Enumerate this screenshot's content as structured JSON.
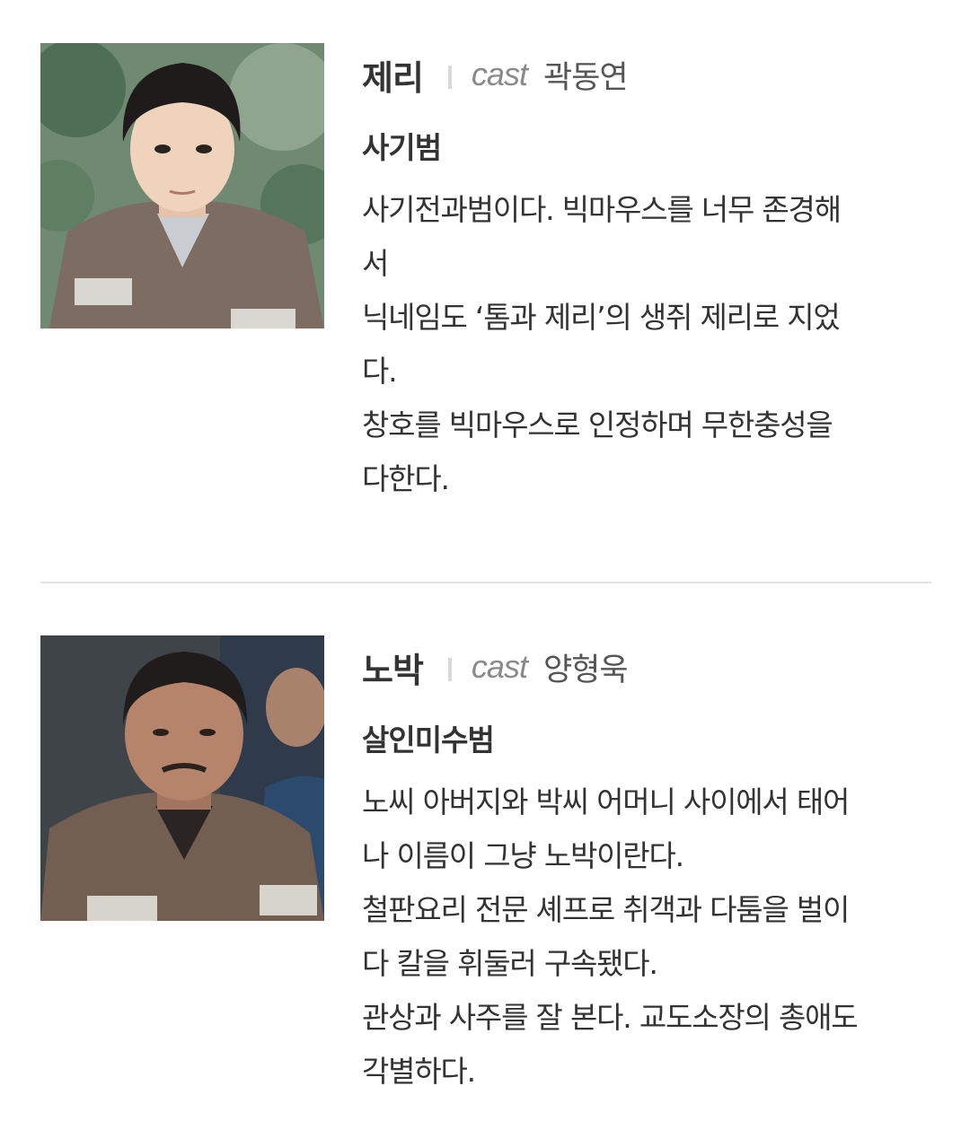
{
  "characters": [
    {
      "name": "제리",
      "cast_label": "cast",
      "actor": "곽동연",
      "role": "사기범",
      "photo_icon": "portrait-photo",
      "description_lines": [
        "사기전과범이다. 빅마우스를 너무 존경해",
        "서",
        "닉네임도 ‘톰과 제리’의 생쥐 제리로 지었",
        "다.",
        "창호를 빅마우스로 인정하며 무한충성을",
        "다한다."
      ]
    },
    {
      "name": "노박",
      "cast_label": "cast",
      "actor": "양형욱",
      "role": "살인미수범",
      "photo_icon": "portrait-photo",
      "description_lines": [
        "노씨 아버지와 박씨 어머니 사이에서 태어",
        "나 이름이 그냥 노박이란다.",
        "철판요리 전문 셰프로 취객과 다툼을 벌이",
        "다 칼을 휘둘러 구속됐다.",
        "관상과 사주를 잘 본다. 교도소장의 총애도",
        "각별하다."
      ]
    }
  ],
  "colors": {
    "text": "#333333",
    "cast_label": "#8a8a8a",
    "divider": "#e3e3e3",
    "uniform": "#7a6a60"
  }
}
